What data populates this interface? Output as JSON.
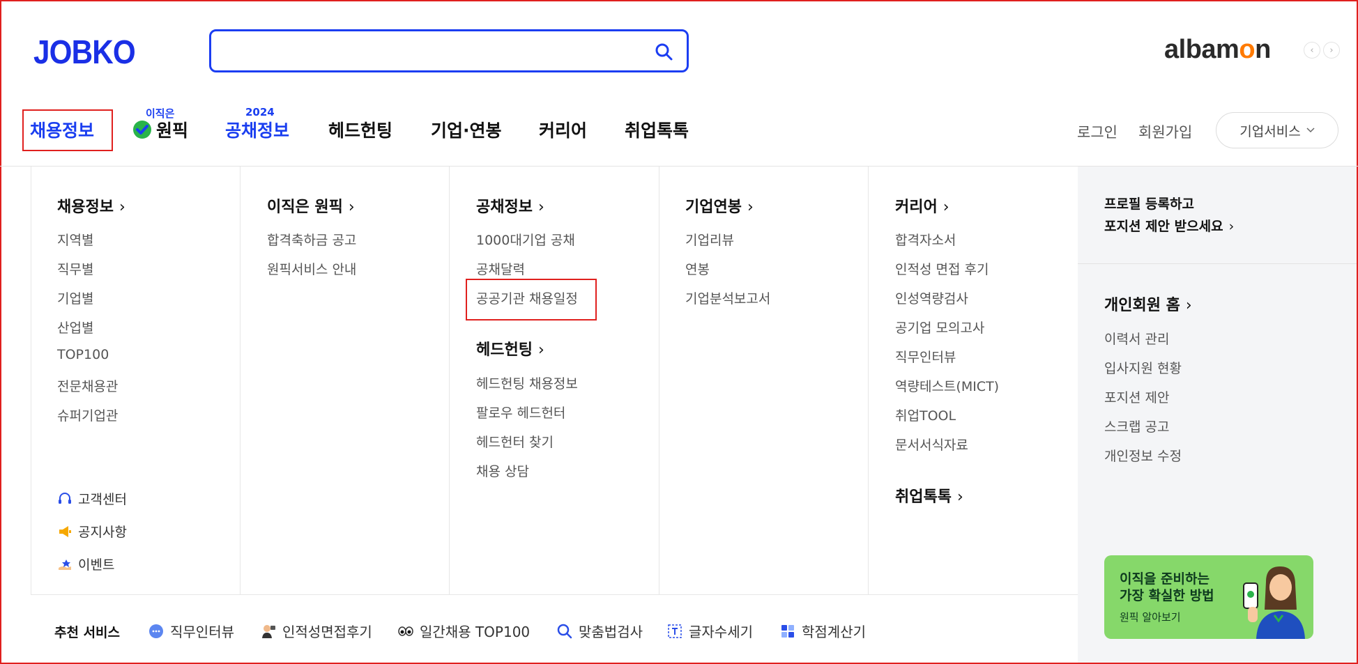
{
  "header": {
    "logo": "JOBKO",
    "search_placeholder": "",
    "brand_right": {
      "part1": "alba",
      "part2": "m",
      "part3": "o",
      "part4": "n"
    }
  },
  "nav": {
    "items": [
      {
        "label": "채용정보"
      },
      {
        "label": "원픽",
        "sup": "이직은"
      },
      {
        "label": "공채정보",
        "sup": "2024"
      },
      {
        "label": "헤드헌팅"
      },
      {
        "label": "기업·연봉"
      },
      {
        "label": "커리어"
      },
      {
        "label": "취업톡톡"
      }
    ],
    "login": "로그인",
    "signup": "회원가입",
    "biz": "기업서비스"
  },
  "menu": {
    "col1": {
      "head": "채용정보",
      "links": [
        "지역별",
        "직무별",
        "기업별",
        "산업별",
        "TOP100",
        "전문채용관",
        "슈퍼기업관"
      ],
      "utils": [
        "고객센터",
        "공지사항",
        "이벤트"
      ]
    },
    "col2": {
      "head": "이직은 원픽",
      "links": [
        "합격축하금 공고",
        "원픽서비스 안내"
      ]
    },
    "col3": {
      "head": "공채정보",
      "links": [
        "1000대기업 공채",
        "공채달력",
        "공공기관 채용일정"
      ],
      "head2": "헤드헌팅",
      "links2": [
        "헤드헌팅 채용정보",
        "팔로우 헤드헌터",
        "헤드헌터 찾기",
        "채용 상담"
      ]
    },
    "col4": {
      "head": "기업연봉",
      "links": [
        "기업리뷰",
        "연봉",
        "기업분석보고서"
      ]
    },
    "col5": {
      "head": "커리어",
      "links": [
        "합격자소서",
        "인적성 면접 후기",
        "인성역량검사",
        "공기업 모의고사",
        "직무인터뷰",
        "역량테스트(MICT)",
        "취업TOOL",
        "문서서식자료"
      ],
      "head2": "취업톡톡"
    },
    "right": {
      "promo_line1": "프로필 등록하고",
      "promo_line2": "포지션 제안 받으세요",
      "head": "개인회원 홈",
      "links": [
        "이력서 관리",
        "입사지원 현황",
        "포지션 제안",
        "스크랩 공고",
        "개인정보 수정"
      ],
      "banner_line1": "이직을 준비하는",
      "banner_line2": "가장 확실한 방법",
      "banner_link": "원픽 알아보기"
    }
  },
  "recommend": {
    "title": "추천 서비스",
    "items": [
      "직무인터뷰",
      "인적성면접후기",
      "일간채용 TOP100",
      "맞춤법검사",
      "글자수세기",
      "학점계산기"
    ]
  },
  "colors": {
    "brand_blue": "#1a3ef0",
    "highlight_red": "#e0201e",
    "banner_green": "#86d86a",
    "alba_orange": "#ff7a00"
  }
}
